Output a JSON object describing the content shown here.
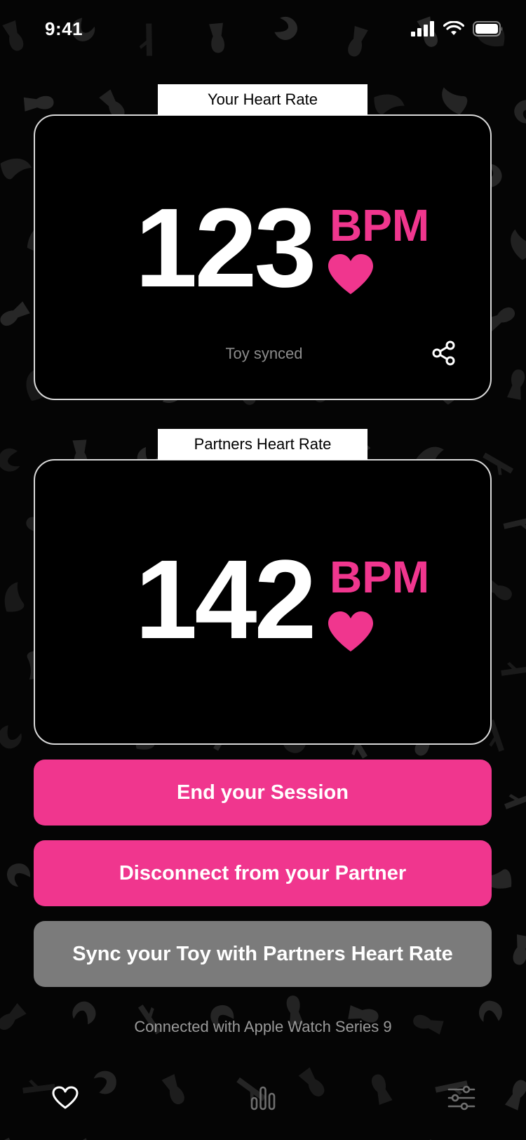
{
  "status_bar": {
    "time": "9:41"
  },
  "your_card": {
    "tab_label": "Your Heart Rate",
    "bpm_value": "123",
    "bpm_unit": "BPM",
    "status": "Toy synced"
  },
  "partner_card": {
    "tab_label": "Partners Heart Rate",
    "bpm_value": "142",
    "bpm_unit": "BPM"
  },
  "actions": {
    "end_session": "End your Session",
    "disconnect": "Disconnect from your Partner",
    "sync_toy": "Sync your Toy with Partners Heart Rate"
  },
  "footer": {
    "connection_text": "Connected with Apple Watch Series 9"
  },
  "tab_bar": {
    "items": [
      "heart-icon",
      "bar-chart-icon",
      "sliders-icon"
    ]
  },
  "colors": {
    "accent": "#f0368e",
    "background": "#000000",
    "secondary_button": "#7b7b7b"
  }
}
